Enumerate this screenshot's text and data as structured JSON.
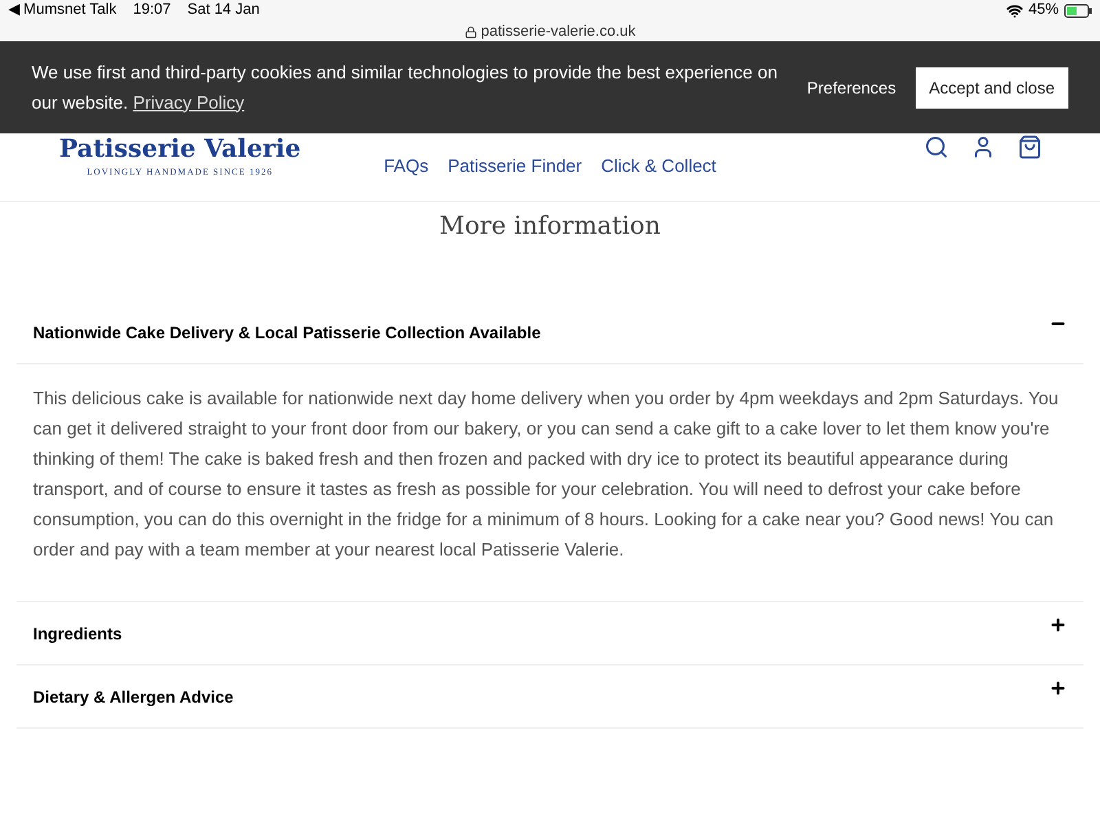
{
  "status_bar": {
    "back": "◀ Mumsnet Talk",
    "time": "19:07",
    "date": "Sat 14 Jan",
    "battery": "45%"
  },
  "address_bar": {
    "url": "patisserie-valerie.co.uk"
  },
  "cookie_banner": {
    "text": "We use first and third-party cookies and similar technologies to provide the best experience on our website.",
    "link": "Privacy Policy",
    "buttons": [
      {
        "label": "Preferences",
        "kind": "text"
      },
      {
        "label": "Accept and close",
        "kind": "primary"
      }
    ]
  },
  "header": {
    "logo": "Patisserie Valerie",
    "tagline": "LOVINGLY HANDMADE SINCE 1926",
    "nav_rows": [
      [
        {
          "label": "FAQs",
          "dropdown": false
        },
        {
          "label": "Patisserie Finder",
          "dropdown": false
        },
        {
          "label": "Click & Collect",
          "dropdown": false
        }
      ]
    ]
  },
  "section": {
    "title": "More information",
    "accordion": [
      {
        "title": "Nationwide Cake Delivery & Local Patisserie Collection Available",
        "expanded": true,
        "body": "This delicious cake is available for nationwide next day home delivery when you order by 4pm weekdays and 2pm Saturdays. You can get it delivered straight to your front door from our bakery, or you can send a cake gift to a cake lover to let them know you're thinking of them! The cake is baked fresh and then frozen and packed with dry ice to protect its beautiful appearance during transport, and of course to ensure it tastes as fresh as possible for your celebration. You will need to defrost your cake before consumption, you can do this overnight in the fridge for a minimum of 8 hours. Looking for a cake near you? Good news! You can order and pay with a team member at your nearest local Patisserie Valerie."
      },
      {
        "title": "Ingredients",
        "expanded": false
      },
      {
        "title": "Dietary & Allergen Advice",
        "expanded": false
      }
    ]
  }
}
